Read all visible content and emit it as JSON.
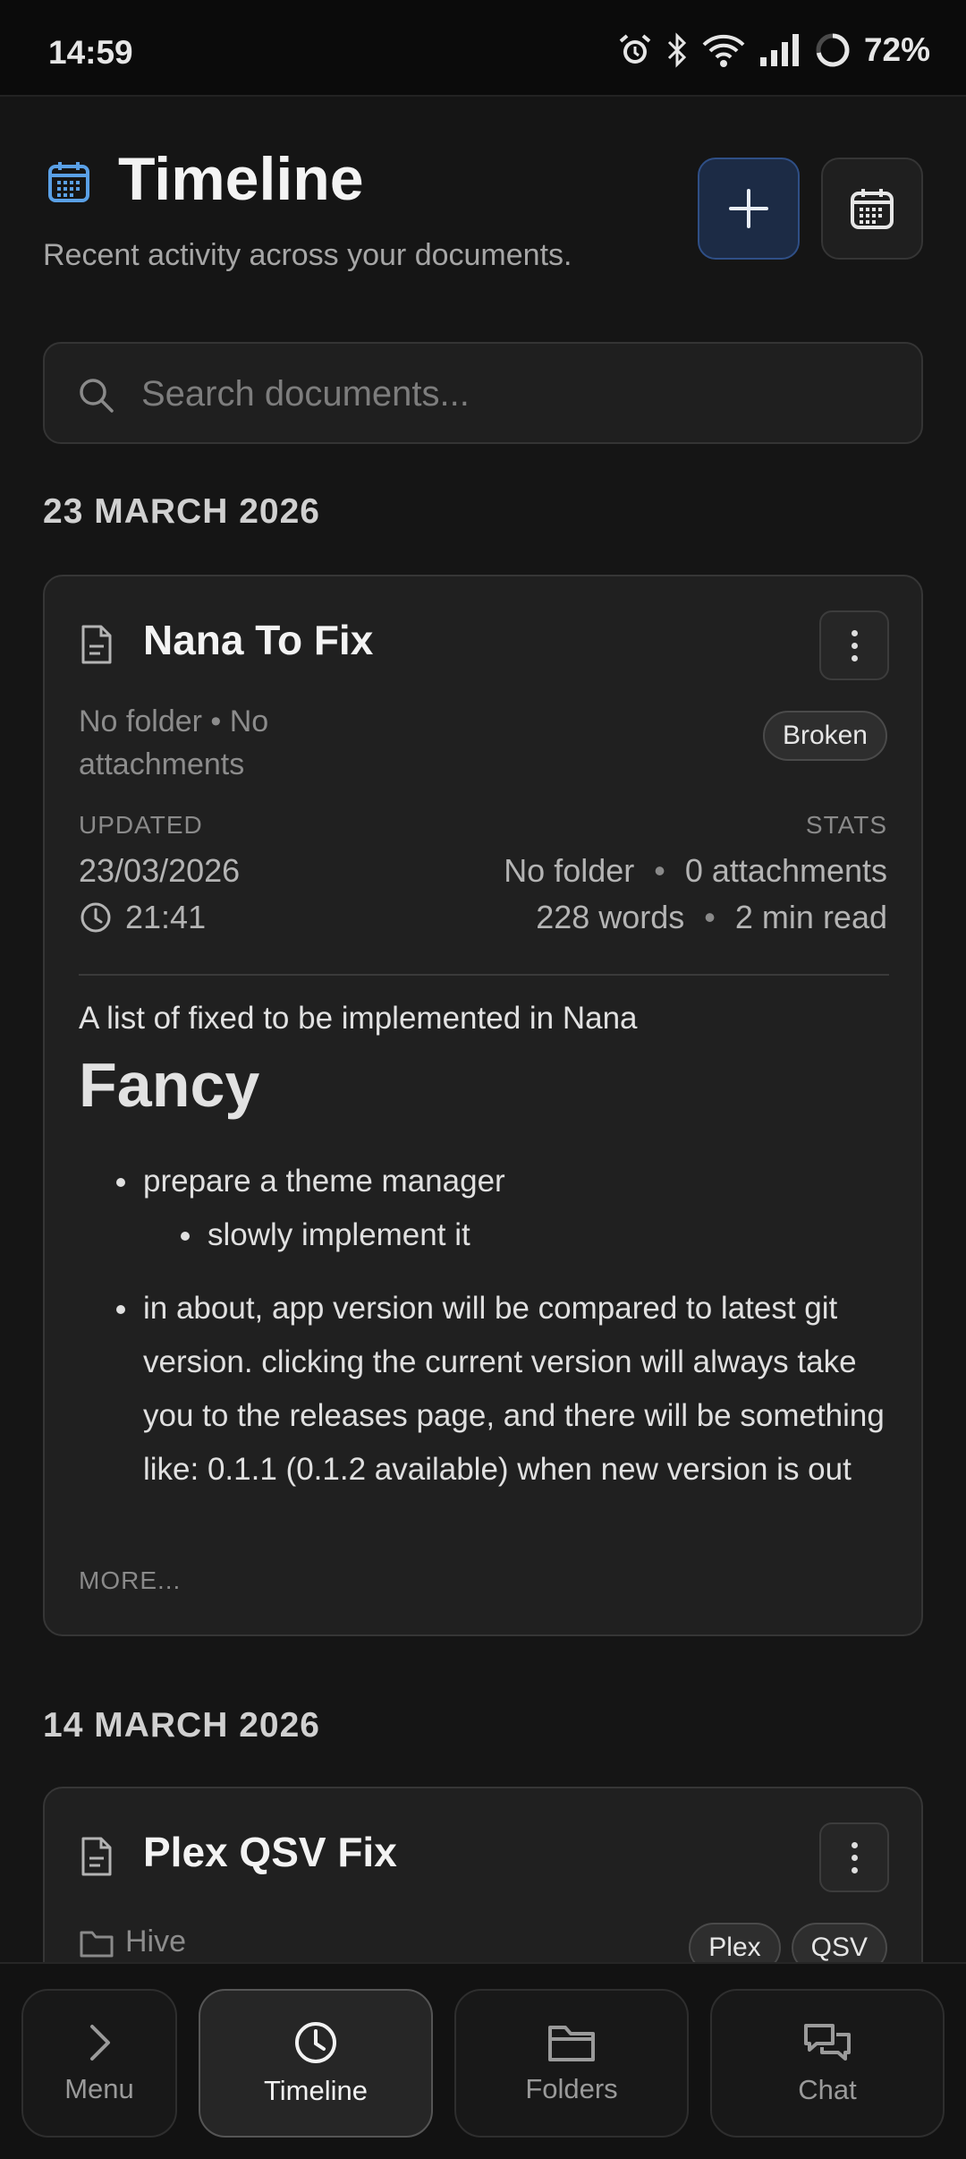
{
  "status_bar": {
    "time": "14:59",
    "battery": "72%",
    "battery_level": 0.72
  },
  "header": {
    "title": "Timeline",
    "subtitle": "Recent activity across your documents."
  },
  "search": {
    "placeholder": "Search documents..."
  },
  "groups": [
    {
      "date": "23 MARCH 2026",
      "card": {
        "title": "Nana To Fix",
        "meta": "No folder • No attachments",
        "tags": [
          "Broken"
        ],
        "updated_label": "UPDATED",
        "updated_date": "23/03/2026",
        "updated_time": "21:41",
        "stats_label": "STATS",
        "stats": {
          "folder": "No folder",
          "attachments": "0 attachments",
          "words": "228 words",
          "read_time": "2 min read"
        },
        "intro": "A list of fixed to be implemented in Nana",
        "heading": "Fancy",
        "bullet_1": "prepare a theme manager",
        "bullet_1_sub": "slowly implement it",
        "bullet_2": "in about, app version will be compared to latest git version. clicking the current version will always take you to the releases page, and there will be something like: 0.1.1 (0.1.2 available) when new version is out",
        "more": "MORE..."
      }
    },
    {
      "date": "14 MARCH 2026",
      "card": {
        "title": "Plex QSV Fix",
        "folder": "Hive",
        "tags": [
          "Plex",
          "QSV"
        ]
      }
    }
  ],
  "nav": [
    {
      "label": "Menu",
      "icon": "chevron-right-icon",
      "active": false
    },
    {
      "label": "Timeline",
      "icon": "clock-icon",
      "active": true
    },
    {
      "label": "Folders",
      "icon": "folder-icon",
      "active": false
    },
    {
      "label": "Chat",
      "icon": "chat-icon",
      "active": false
    }
  ],
  "colors": {
    "background": "#151515",
    "card": "#202020",
    "accent": "#5aa0e6",
    "add_button": "#1c2b45"
  }
}
